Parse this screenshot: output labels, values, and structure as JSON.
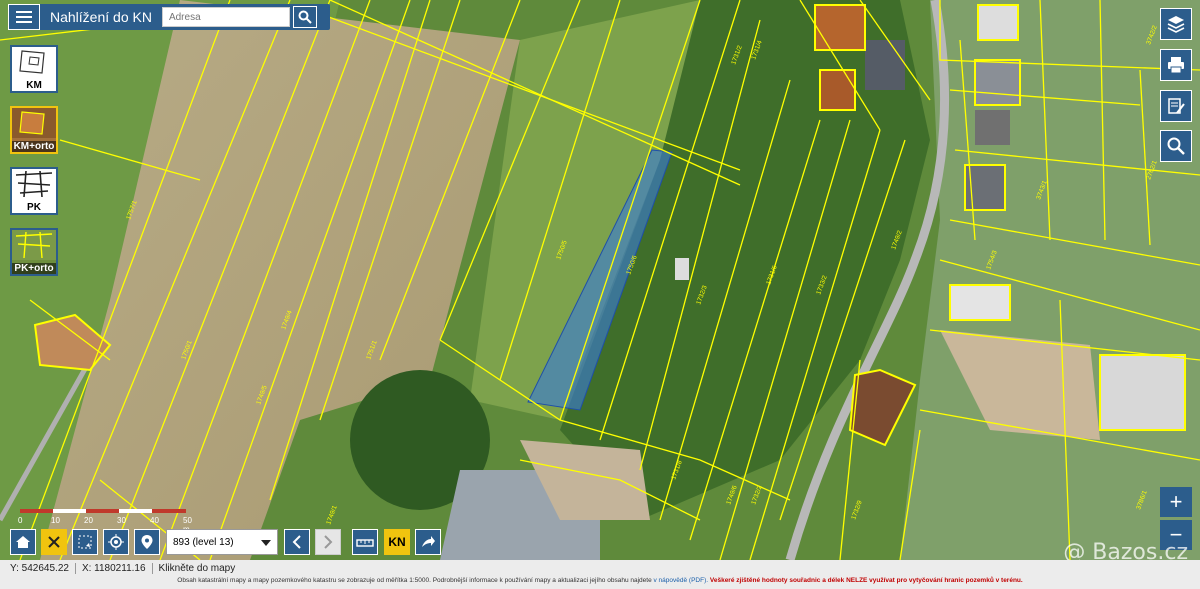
{
  "app": {
    "title": "Nahlížení do KN"
  },
  "search": {
    "placeholder": "Adresa"
  },
  "layers": [
    {
      "id": "km",
      "label": "KM",
      "active": false
    },
    {
      "id": "km-orto",
      "label": "KM+orto",
      "active": true
    },
    {
      "id": "pk",
      "label": "PK",
      "active": false
    },
    {
      "id": "pk-orto",
      "label": "PK+orto",
      "active": false
    }
  ],
  "toolbar": {
    "level": "893 (level 13)",
    "kn_label": "KN"
  },
  "scale": {
    "ticks": [
      "0",
      "10",
      "20",
      "30",
      "40",
      "50 m"
    ]
  },
  "status": {
    "y_coord": "Y: 542645.22",
    "x_coord": "X: 1180211.16",
    "hint": "Klikněte do mapy",
    "disclaimer": "Obsah katastrální mapy a mapy pozemkového katastru se zobrazuje od měřítka 1:5000. Podrobnější informace k používání mapy a aktualizaci jejího obsahu najdete",
    "help_link": "v nápovědě (PDF).",
    "warning": "Veškeré zjištěné hodnoty souřadnic a délek NELZE využívat pro vytyčování hranic pozemků v terénu."
  },
  "watermark": "@ Bazos.cz",
  "map": {
    "parcel_labels": [
      "1750/1",
      "1751/1",
      "1749/5",
      "1749/4",
      "1750/5",
      "1750/6",
      "1731/2",
      "1731/4",
      "1732/3",
      "1733/2",
      "1731/8",
      "1732/2",
      "1732/9",
      "1749/6",
      "1749/1",
      "1754/3",
      "3786/1",
      "1749/2",
      "1731/6",
      "3742/2",
      "2762/1",
      "3743/1",
      "1757/1"
    ],
    "colors": {
      "parcel_line": "#ffff00",
      "highlight_fill": "#3a7bd5"
    }
  }
}
